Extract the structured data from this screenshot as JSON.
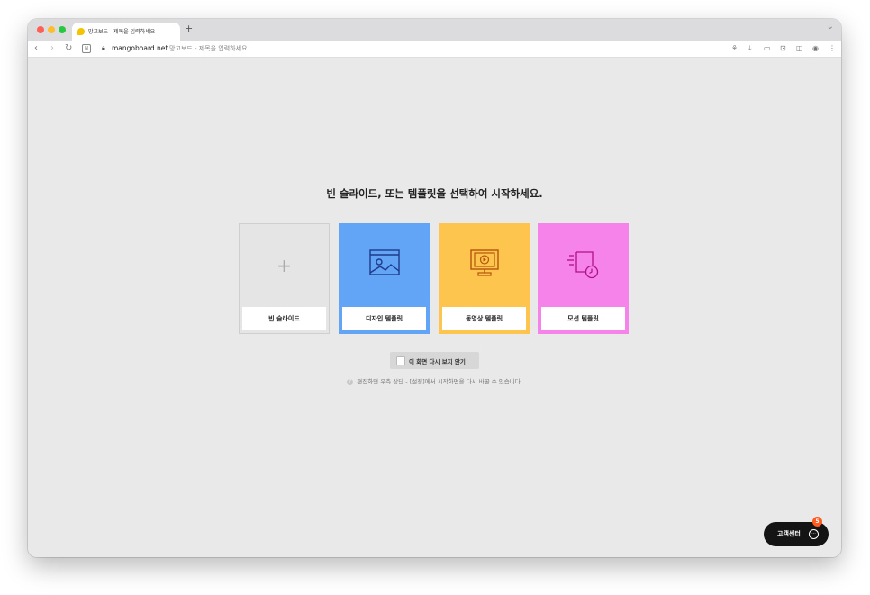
{
  "browser": {
    "tab_title": "망고보드 - 제목을 입력하세요",
    "new_tab_label": "+",
    "url_domain": "mangoboard.net",
    "url_title": "망고보드 - 제목을 입력하세요"
  },
  "main": {
    "headline": "빈 슬라이드, 또는 템플릿을 선택하여 시작하세요.",
    "cards": [
      {
        "label": "빈 슬라이드",
        "icon": "plus-icon",
        "color": "#e5e5e5"
      },
      {
        "label": "디자인 템플릿",
        "icon": "image-icon",
        "color": "#62a4f5"
      },
      {
        "label": "동영상 템플릿",
        "icon": "video-monitor-icon",
        "color": "#fdc54d"
      },
      {
        "label": "모션 템플릿",
        "icon": "motion-clock-icon",
        "color": "#f583e9"
      }
    ],
    "dont_show_label": "이 화면 다시 보지 않기",
    "hint_text": "편집화면 우측 상단 - [설정]에서 시작화면을 다시 바꿀 수 있습니다."
  },
  "support": {
    "label": "고객센터",
    "badge_count": "5"
  }
}
